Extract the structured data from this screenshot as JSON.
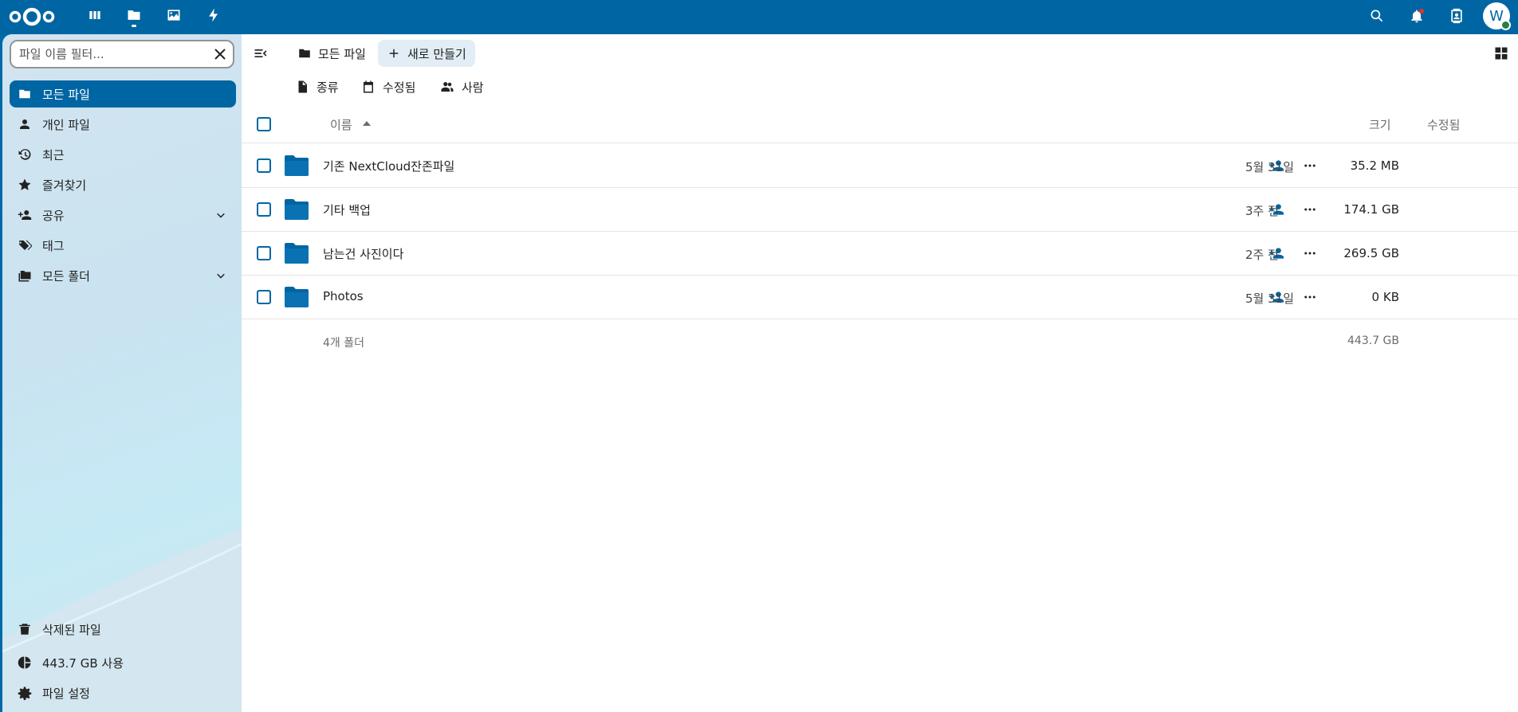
{
  "header": {
    "apps": [
      {
        "icon": "dashboard-icon",
        "label": "Dashboard"
      },
      {
        "icon": "folder-icon",
        "label": "Files"
      },
      {
        "icon": "image-icon",
        "label": "Photos"
      },
      {
        "icon": "activity-icon",
        "label": "Activity"
      }
    ],
    "avatar_letter": "W"
  },
  "sidebar": {
    "filter_placeholder": "파일 이름 필터...",
    "items": [
      {
        "label": "모든 파일",
        "icon": "folder-icon",
        "active": true
      },
      {
        "label": "개인 파일",
        "icon": "person-icon"
      },
      {
        "label": "최근",
        "icon": "history-icon"
      },
      {
        "label": "즐겨찾기",
        "icon": "star-icon"
      },
      {
        "label": "공유",
        "icon": "share-icon",
        "expandable": true
      },
      {
        "label": "태그",
        "icon": "tag-icon"
      },
      {
        "label": "모든 폴더",
        "icon": "folders-icon",
        "expandable": true
      }
    ],
    "footer": {
      "trash": "삭제된 파일",
      "usage": "443.7 GB 사용",
      "settings": "파일 설정"
    }
  },
  "toolbar": {
    "breadcrumb": "모든 파일",
    "new_button": "새로 만들기"
  },
  "filters": {
    "type": "종류",
    "modified": "수정됨",
    "people": "사람"
  },
  "table": {
    "col_name": "이름",
    "col_size": "크기",
    "col_modified": "수정됨",
    "rows": [
      {
        "name": "기존 NextCloud잔존파일",
        "size": "35.2 MB",
        "modified": "5월 31일"
      },
      {
        "name": "기타 백업",
        "size": "174.1 GB",
        "modified": "3주 전"
      },
      {
        "name": "남는건 사진이다",
        "size": "269.5 GB",
        "modified": "2주 전"
      },
      {
        "name": "Photos",
        "size": "0 KB",
        "modified": "5월 31일"
      }
    ],
    "summary_count": "4개 폴더",
    "summary_size": "443.7 GB"
  },
  "colors": {
    "brand": "#0066a3",
    "sidebar_bg": "#cfe5f1",
    "new_button_bg": "#e2edf5",
    "status_online": "#2d7b41",
    "notification_dot": "#e9322d"
  }
}
